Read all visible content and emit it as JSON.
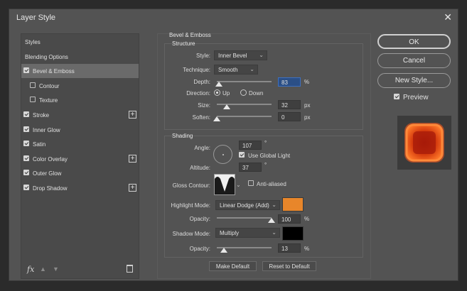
{
  "window": {
    "title": "Layer Style",
    "close": "✕"
  },
  "styles_list": {
    "items": [
      {
        "label": "Styles",
        "checkbox": false,
        "checked": false,
        "indent": false,
        "plus": false,
        "selected": false
      },
      {
        "label": "Blending Options",
        "checkbox": false,
        "checked": false,
        "indent": false,
        "plus": false,
        "selected": false
      },
      {
        "label": "Bevel & Emboss",
        "checkbox": true,
        "checked": true,
        "indent": false,
        "plus": false,
        "selected": true
      },
      {
        "label": "Contour",
        "checkbox": true,
        "checked": false,
        "indent": true,
        "plus": false,
        "selected": false
      },
      {
        "label": "Texture",
        "checkbox": true,
        "checked": false,
        "indent": true,
        "plus": false,
        "selected": false
      },
      {
        "label": "Stroke",
        "checkbox": true,
        "checked": true,
        "indent": false,
        "plus": true,
        "selected": false
      },
      {
        "label": "Inner Glow",
        "checkbox": true,
        "checked": true,
        "indent": false,
        "plus": false,
        "selected": false
      },
      {
        "label": "Satin",
        "checkbox": true,
        "checked": true,
        "indent": false,
        "plus": false,
        "selected": false
      },
      {
        "label": "Color Overlay",
        "checkbox": true,
        "checked": true,
        "indent": false,
        "plus": true,
        "selected": false
      },
      {
        "label": "Outer Glow",
        "checkbox": true,
        "checked": true,
        "indent": false,
        "plus": false,
        "selected": false
      },
      {
        "label": "Drop Shadow",
        "checkbox": true,
        "checked": true,
        "indent": false,
        "plus": true,
        "selected": false
      }
    ],
    "fx": "fx"
  },
  "bevel": {
    "title": "Bevel & Emboss",
    "structure": {
      "title": "Structure",
      "style_label": "Style:",
      "style_value": "Inner Bevel",
      "technique_label": "Technique:",
      "technique_value": "Smooth",
      "depth_label": "Depth:",
      "depth_value": "83",
      "depth_unit": "%",
      "direction_label": "Direction:",
      "dir_up": "Up",
      "dir_down": "Down",
      "size_label": "Size:",
      "size_value": "32",
      "size_unit": "px",
      "soften_label": "Soften:",
      "soften_value": "0",
      "soften_unit": "px"
    },
    "shading": {
      "title": "Shading",
      "angle_label": "Angle:",
      "angle_value": "107",
      "angle_unit": "°",
      "use_global_light": "Use Global Light",
      "altitude_label": "Altitude:",
      "altitude_value": "37",
      "altitude_unit": "°",
      "gloss_label": "Gloss Contour:",
      "anti_aliased": "Anti-aliased",
      "highlight_label": "Highlight Mode:",
      "highlight_value": "Linear Dodge (Add)",
      "highlight_opacity_label": "Opacity:",
      "highlight_opacity_value": "100",
      "highlight_opacity_unit": "%",
      "shadow_label": "Shadow Mode:",
      "shadow_value": "Multiply",
      "shadow_opacity_label": "Opacity:",
      "shadow_opacity_value": "13",
      "shadow_opacity_unit": "%"
    },
    "make_default": "Make Default",
    "reset_default": "Reset to Default"
  },
  "colors": {
    "highlight": "#e8862a",
    "shadow": "#000000",
    "accent": "#2b4f86"
  },
  "right": {
    "ok": "OK",
    "cancel": "Cancel",
    "new_style": "New Style...",
    "preview": "Preview"
  }
}
